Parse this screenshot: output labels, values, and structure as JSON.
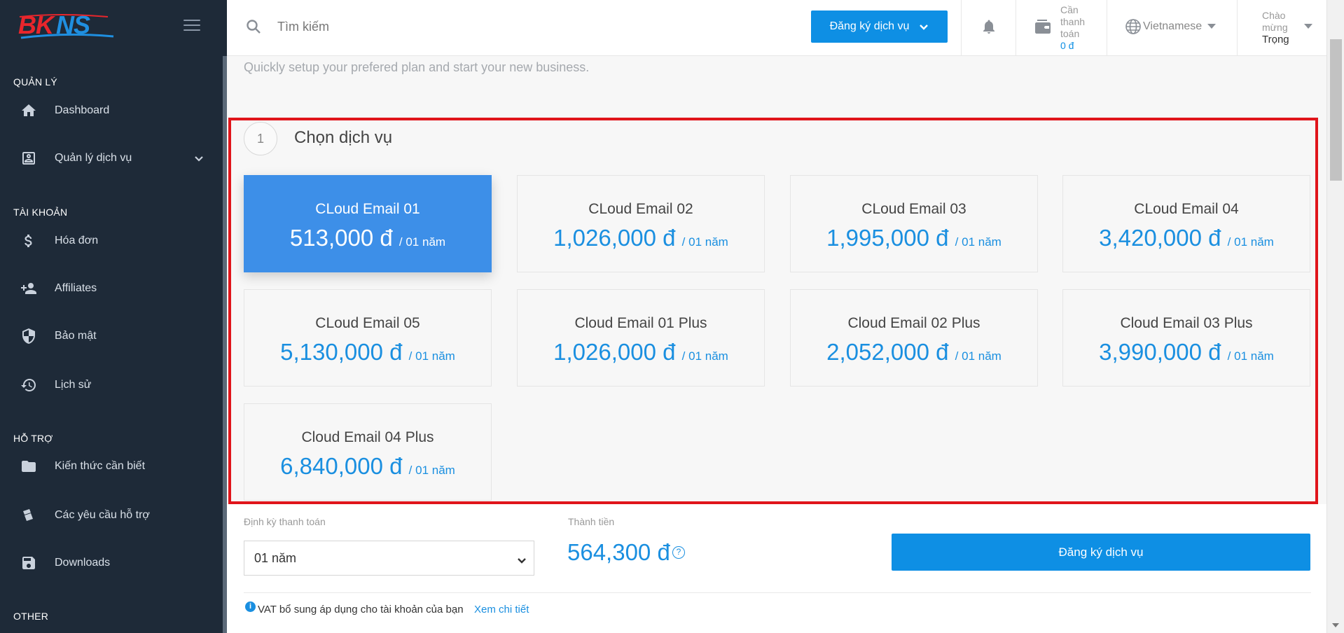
{
  "brand": {
    "logo_text": "BKNS"
  },
  "sidebar": {
    "sections": [
      {
        "title": "QUẢN LÝ"
      },
      {
        "title": "TÀI KHOẢN"
      },
      {
        "title": "HỖ TRỢ"
      },
      {
        "title": "OTHER"
      }
    ],
    "items": [
      {
        "label": "Dashboard",
        "icon": "home-icon"
      },
      {
        "label": "Quản lý dịch vụ",
        "icon": "contact-card-icon"
      },
      {
        "label": "Hóa đơn",
        "icon": "dollar-icon"
      },
      {
        "label": "Affiliates",
        "icon": "add-user-icon"
      },
      {
        "label": "Bảo mật",
        "icon": "shield-icon"
      },
      {
        "label": "Lịch sử",
        "icon": "history-icon"
      },
      {
        "label": "Kiến thức cần biết",
        "icon": "folder-icon"
      },
      {
        "label": "Các yêu cầu hỗ trợ",
        "icon": "tickets-icon"
      },
      {
        "label": "Downloads",
        "icon": "save-icon"
      }
    ]
  },
  "topbar": {
    "search_placeholder": "Tìm kiếm",
    "register_label": "Đăng ký dịch vụ",
    "payment_label": "Cần thanh toán",
    "payment_amount": "0 đ",
    "language": "Vietnamese",
    "greeting": "Chào mừng",
    "user_name": "Trọng"
  },
  "main": {
    "subtitle": "Quickly setup your prefered plan and start your new business.",
    "step_number": "1",
    "step_title": "Chọn dịch vụ",
    "period_suffix": "/ 01 năm",
    "plans": [
      {
        "name": "CLoud Email 01",
        "price": "513,000 đ",
        "selected": true
      },
      {
        "name": "CLoud Email 02",
        "price": "1,026,000 đ"
      },
      {
        "name": "CLoud Email 03",
        "price": "1,995,000 đ"
      },
      {
        "name": "CLoud Email 04",
        "price": "3,420,000 đ"
      },
      {
        "name": "CLoud Email 05",
        "price": "5,130,000 đ"
      },
      {
        "name": "Cloud Email 01 Plus",
        "price": "1,026,000 đ"
      },
      {
        "name": "Cloud Email 02 Plus",
        "price": "2,052,000 đ"
      },
      {
        "name": "Cloud Email 03 Plus",
        "price": "3,990,000 đ"
      },
      {
        "name": "Cloud Email 04 Plus",
        "price": "6,840,000 đ"
      }
    ]
  },
  "checkout": {
    "cycle_label": "Định kỳ thanh toán",
    "cycle_value": "01 năm",
    "total_label": "Thành tiền",
    "total_value": "564,300 đ",
    "help_symbol": "?",
    "register_label": "Đăng ký dịch vụ",
    "vat_icon_symbol": "i",
    "vat_text": "VAT bổ sung áp dụng cho tài khoản của bạn",
    "vat_link": "Xem chi tiết"
  },
  "colors": {
    "sidebar_bg": "#1e2a38",
    "accent": "#0e8fe4",
    "selected_plan": "#3d8fe8",
    "highlight_border": "#e0151b"
  }
}
